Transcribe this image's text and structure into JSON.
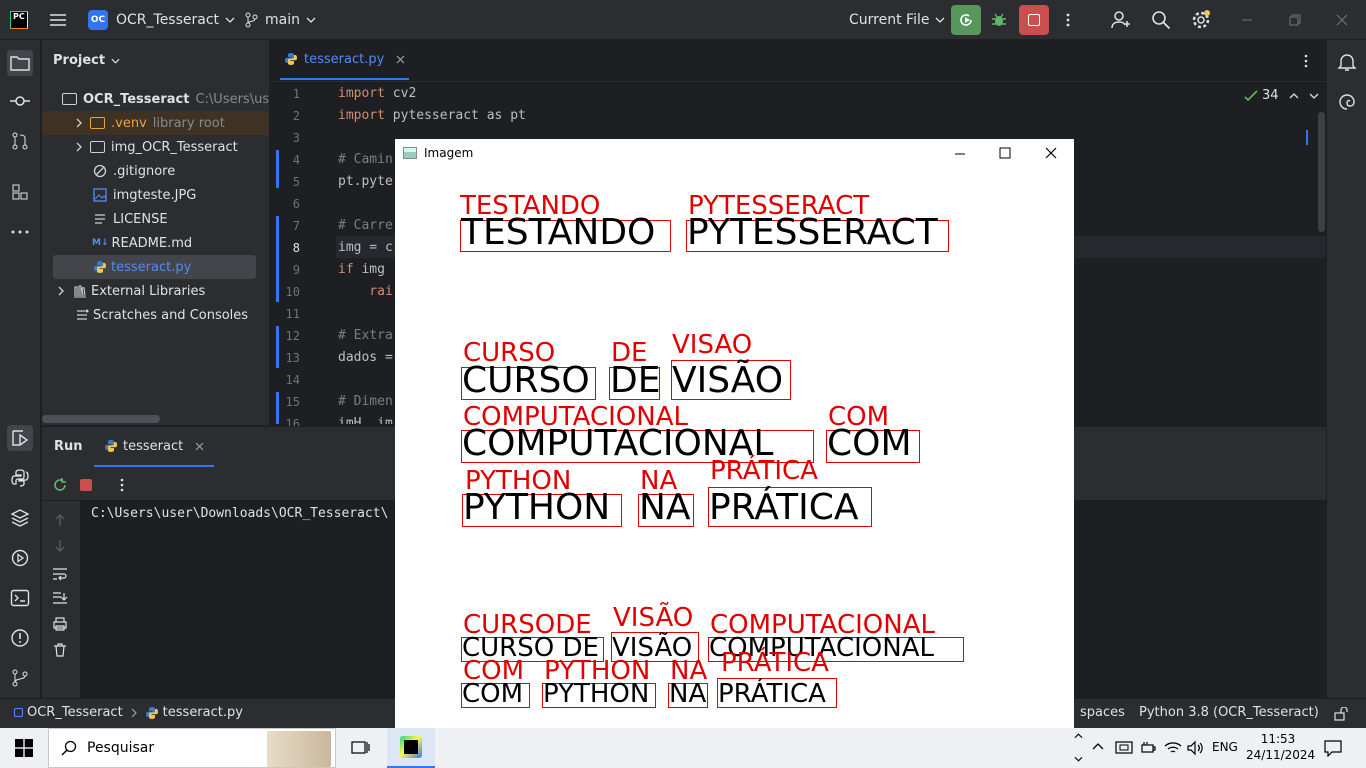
{
  "titlebar": {
    "logo": "PC",
    "project_badge": "OC",
    "project_name": "OCR_Tesseract",
    "branch": "main",
    "run_config": "Current File",
    "icons": [
      "hamburger-menu-icon",
      "branch-icon",
      "run-icon",
      "debug-icon",
      "stop-icon",
      "more-icon",
      "add-user-icon",
      "search-icon",
      "settings-icon",
      "minimize-icon",
      "restore-icon",
      "close-icon"
    ]
  },
  "project_panel": {
    "title": "Project",
    "items": [
      {
        "label": "OCR_Tesseract",
        "muted": "C:\\Users\\us"
      },
      {
        "label": ".venv",
        "muted": "library root"
      },
      {
        "label": "img_OCR_Tesseract",
        "muted": ""
      },
      {
        "label": ".gitignore",
        "muted": ""
      },
      {
        "label": "imgteste.JPG",
        "muted": ""
      },
      {
        "label": "LICENSE",
        "muted": ""
      },
      {
        "label": "README.md",
        "muted": ""
      },
      {
        "label": "tesseract.py",
        "muted": ""
      },
      {
        "label": "External Libraries",
        "muted": ""
      },
      {
        "label": "Scratches and Consoles",
        "muted": ""
      }
    ]
  },
  "editor": {
    "tab": "tesseract.py",
    "inspection_count": "34",
    "line_numbers": [
      "1",
      "2",
      "3",
      "4",
      "5",
      "6",
      "7",
      "8",
      "9",
      "10",
      "11",
      "12",
      "13",
      "14",
      "15",
      "16"
    ],
    "lines": [
      {
        "kw": "import",
        "rest": " cv2"
      },
      {
        "kw": "import",
        "rest": " pytesseract as pt"
      },
      {
        "kw": "",
        "rest": ""
      },
      {
        "kw": "",
        "rest": "# Camin"
      },
      {
        "kw": "",
        "rest": "pt.pyte"
      },
      {
        "kw": "",
        "rest": ""
      },
      {
        "kw": "",
        "rest": "# Carre"
      },
      {
        "kw": "",
        "rest": "img = c"
      },
      {
        "kw": "if",
        "rest": " img"
      },
      {
        "kw": "",
        "rest": "    rai"
      },
      {
        "kw": "",
        "rest": ""
      },
      {
        "kw": "",
        "rest": "# Extra"
      },
      {
        "kw": "",
        "rest": "dados ="
      },
      {
        "kw": "",
        "rest": ""
      },
      {
        "kw": "",
        "rest": "# Dimen"
      },
      {
        "kw": "",
        "rest": "imH, im"
      }
    ]
  },
  "run_panel": {
    "title": "Run",
    "tab": "tesseract",
    "console_text": "C:\\Users\\user\\Downloads\\OCR_Tesseract\\"
  },
  "statusbar": {
    "breadcrumb_project": "OCR_Tesseract",
    "breadcrumb_file": "tesseract.py",
    "indent": "spaces",
    "interpreter": "Python 3.8 (OCR_Tesseract)"
  },
  "image_window": {
    "title": "Imagem",
    "words": [
      {
        "top_label": "TESTANDO",
        "box_text": "TESTANDO"
      },
      {
        "top_label": "PYTESSERACT",
        "box_text": "PYTESSERACT"
      },
      {
        "top_label": "CURSO",
        "box_text": "CURSO"
      },
      {
        "top_label": "DE",
        "box_text": "DE"
      },
      {
        "top_label": "VISAO",
        "box_text": "VISÃO"
      },
      {
        "top_label": "COMPUTACIONAL",
        "box_text": "COMPUTACIONAL"
      },
      {
        "top_label": "COM",
        "box_text": "COM"
      },
      {
        "top_label": "PYTHON",
        "box_text": "PYTHON"
      },
      {
        "top_label": "NA",
        "box_text": "NA"
      },
      {
        "top_label": "PRÁTICA",
        "box_text": "PRÁTICA"
      },
      {
        "top_label": "CURSODE",
        "box_text": "CURSO DE"
      },
      {
        "top_label": "VISÃO",
        "box_text": "VISÃO"
      },
      {
        "top_label": "COMPUTACIONAL",
        "box_text": "COMPUTACIONAL"
      },
      {
        "top_label": "COM",
        "box_text": "COM"
      },
      {
        "top_label": "PYTHON",
        "box_text": "PYTHON"
      },
      {
        "top_label": "NA",
        "box_text": "NA"
      },
      {
        "top_label": "PRÁTICA",
        "box_text": "PRÁTICA"
      }
    ]
  },
  "taskbar": {
    "search_placeholder": "Pesquisar",
    "language": "ENG",
    "time": "11:53",
    "date": "24/11/2024"
  }
}
